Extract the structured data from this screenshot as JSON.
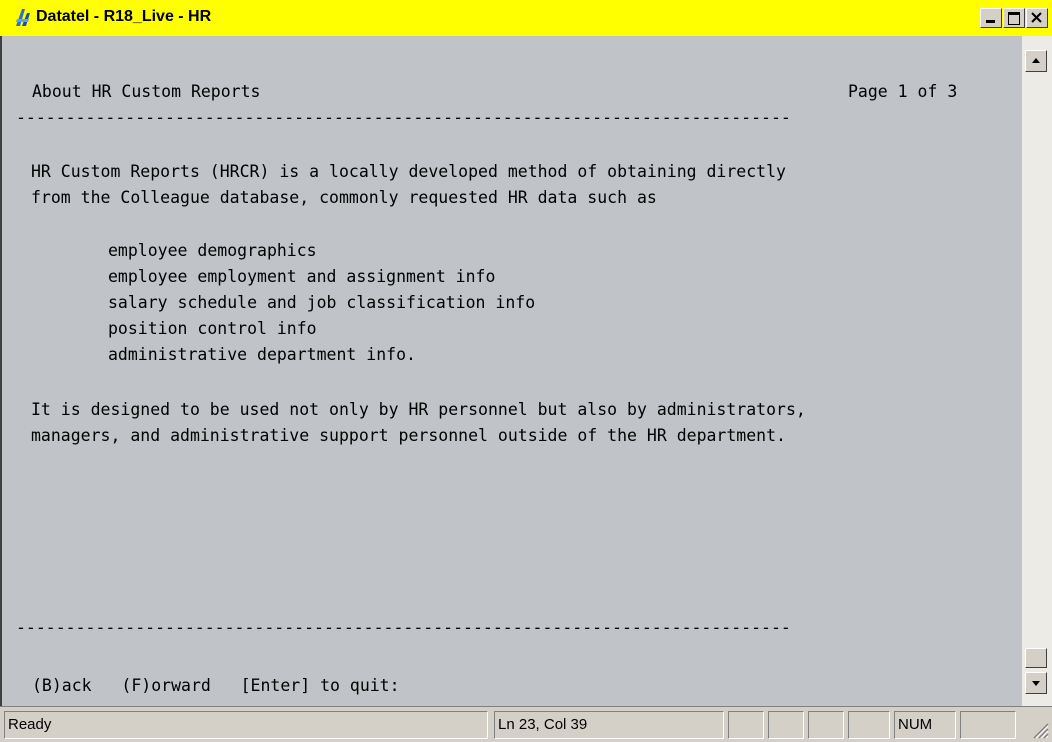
{
  "window": {
    "title": "Datatel - R18_Live - HR",
    "app_icon": "datatel-icon",
    "buttons": {
      "minimize": "minimize-icon",
      "maximize": "maximize-icon",
      "close": "close-icon"
    }
  },
  "screen": {
    "header_title": "About HR Custom Reports",
    "page_indicator": "Page 1 of 3",
    "separator_top": "------------------------------------------------------------------------------",
    "paragraph1": [
      "HR Custom Reports (HRCR) is a locally developed method of obtaining directly",
      "from the Colleague database, commonly requested HR data such as"
    ],
    "list_items": [
      "employee demographics",
      "employee employment and assignment info",
      "salary schedule and job classification info",
      "position control info",
      "administrative department info."
    ],
    "paragraph2": [
      "It is designed to be used not only by HR personnel but also by administrators,",
      "managers, and administrative support personnel outside of the HR department."
    ],
    "separator_bottom": "------------------------------------------------------------------------------",
    "prompt": "(B)ack   (F)orward   [Enter] to quit:"
  },
  "statusbar": {
    "status": "Ready",
    "cursor": "Ln 23, Col 39",
    "num": "NUM"
  }
}
